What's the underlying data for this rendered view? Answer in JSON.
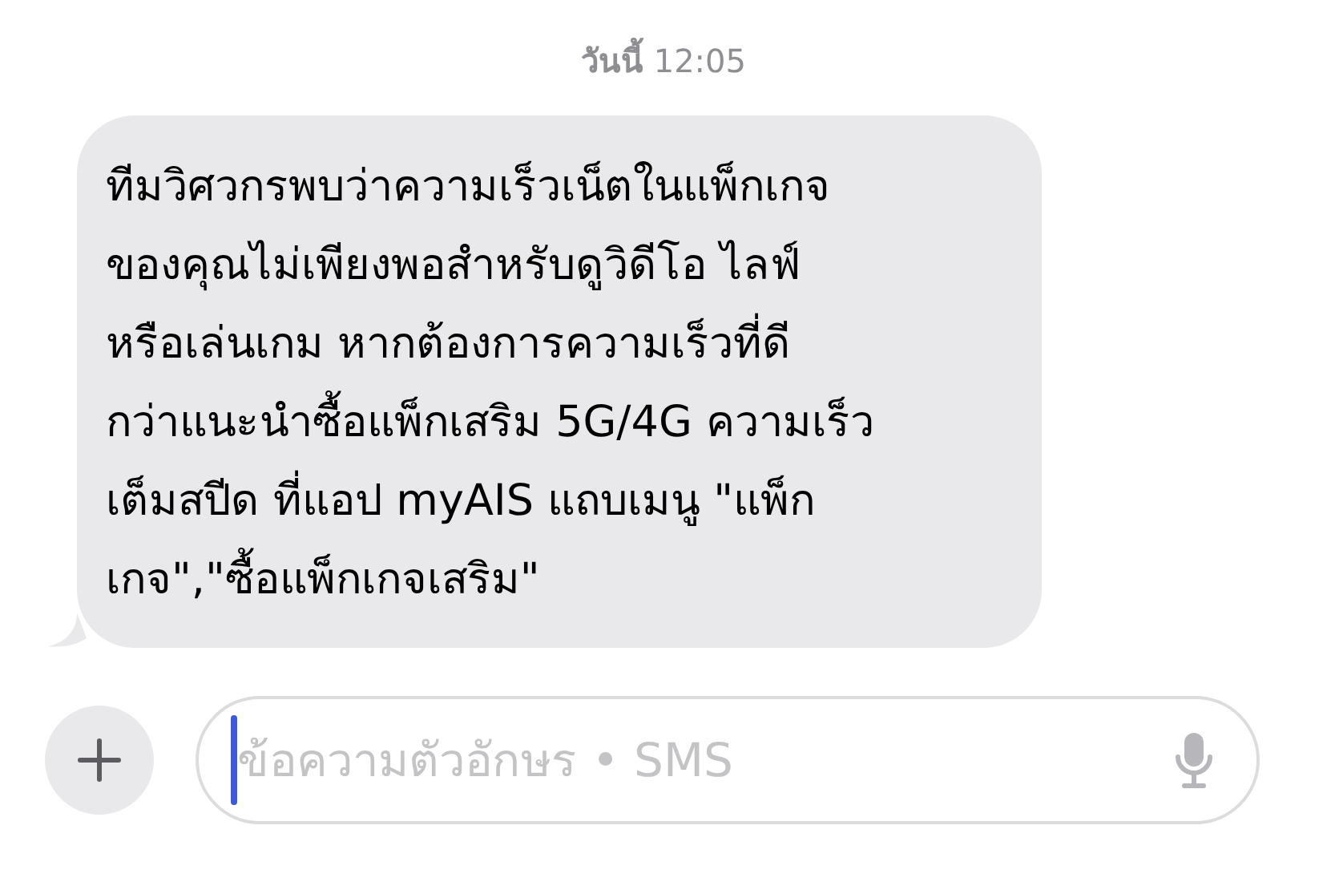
{
  "timestamp": "**วันนี้** 12:05",
  "message": {
    "text": "ทีมวิศวกรพบว่าความเร็วเน็ตในแพ็กเกจ\nของคุณไม่เพียงพอสำหรับดูวิดีโอ ไลฟ์\nหรือเล่นเกม หากต้องการความเร็วที่ดี\nกว่าแนะนำซื้อแพ็กเสริม 5G/4G ความเร็ว\nเต็มสปีด ที่แอป myAIS แถบเมนู \"แพ็ก\nเกจ\",\"ซื้อแพ็กเกจเสริม\"",
    "incoming": true
  },
  "composer": {
    "placeholder": "ข้อความตัวอักษร • SMS"
  }
}
